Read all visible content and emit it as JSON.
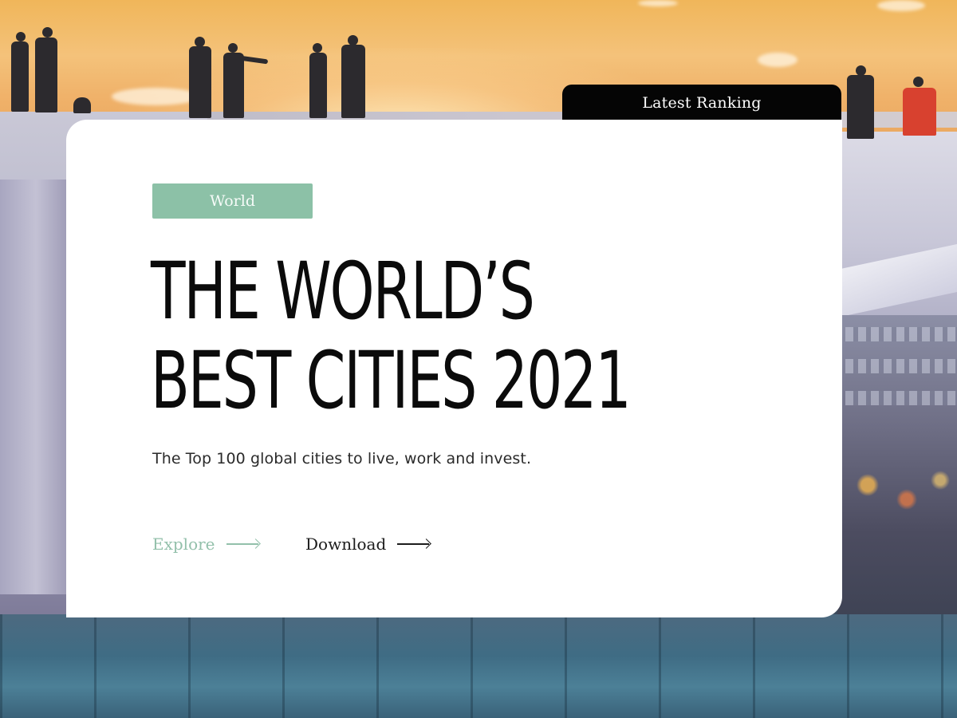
{
  "tab": {
    "label": "Latest Ranking"
  },
  "card": {
    "category": "World",
    "headline_line1": "THE WORLD’S",
    "headline_line2": "BEST CITIES 2021",
    "subtitle": "The Top 100 global cities to live, work and invest.",
    "links": [
      {
        "label": "Explore",
        "icon": "arrow-right-icon",
        "color": "#93c0ab"
      },
      {
        "label": "Download",
        "icon": "arrow-right-icon",
        "color": "#1c1c1c"
      }
    ]
  },
  "colors": {
    "tab_bg": "#050505",
    "pill_bg": "#8cc1a7",
    "card_bg": "#ffffff"
  }
}
